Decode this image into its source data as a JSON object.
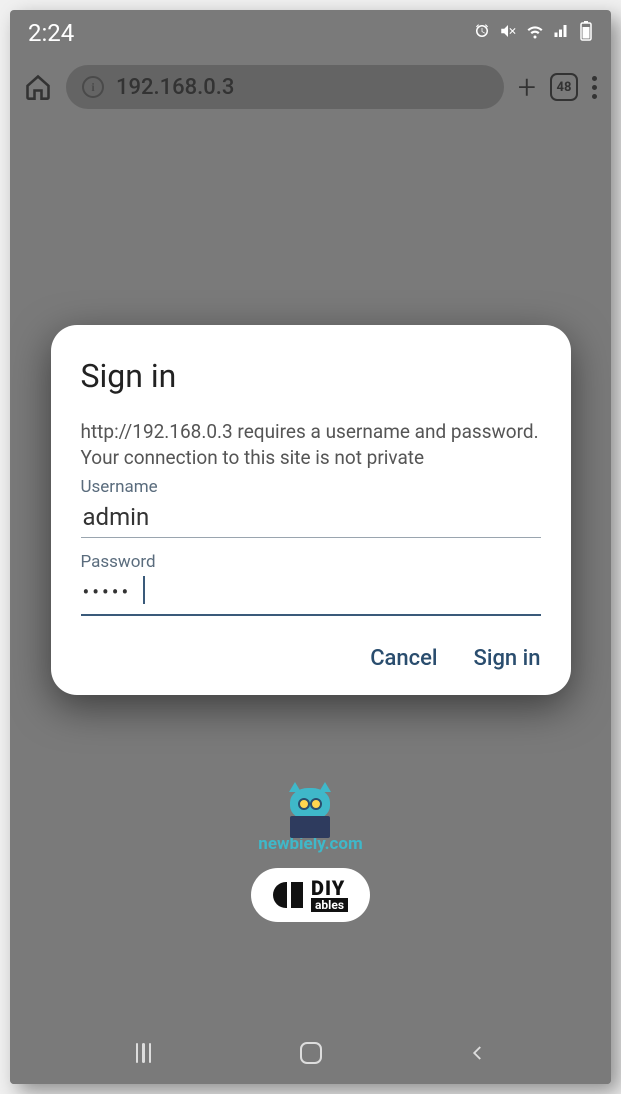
{
  "status_bar": {
    "time": "2:24"
  },
  "browser": {
    "url": "192.168.0.3",
    "tab_count": "48"
  },
  "dialog": {
    "title": "Sign in",
    "message": "http://192.168.0.3 requires a username and password. Your connection to this site is not private",
    "username_label": "Username",
    "username_value": "admin",
    "password_label": "Password",
    "password_value": "•••••",
    "cancel_label": "Cancel",
    "signin_label": "Sign in"
  },
  "watermark": "newbiely.com",
  "logos": {
    "owl_text": "newbiely.com",
    "diy_big": "DIY",
    "diy_small": "ables"
  }
}
